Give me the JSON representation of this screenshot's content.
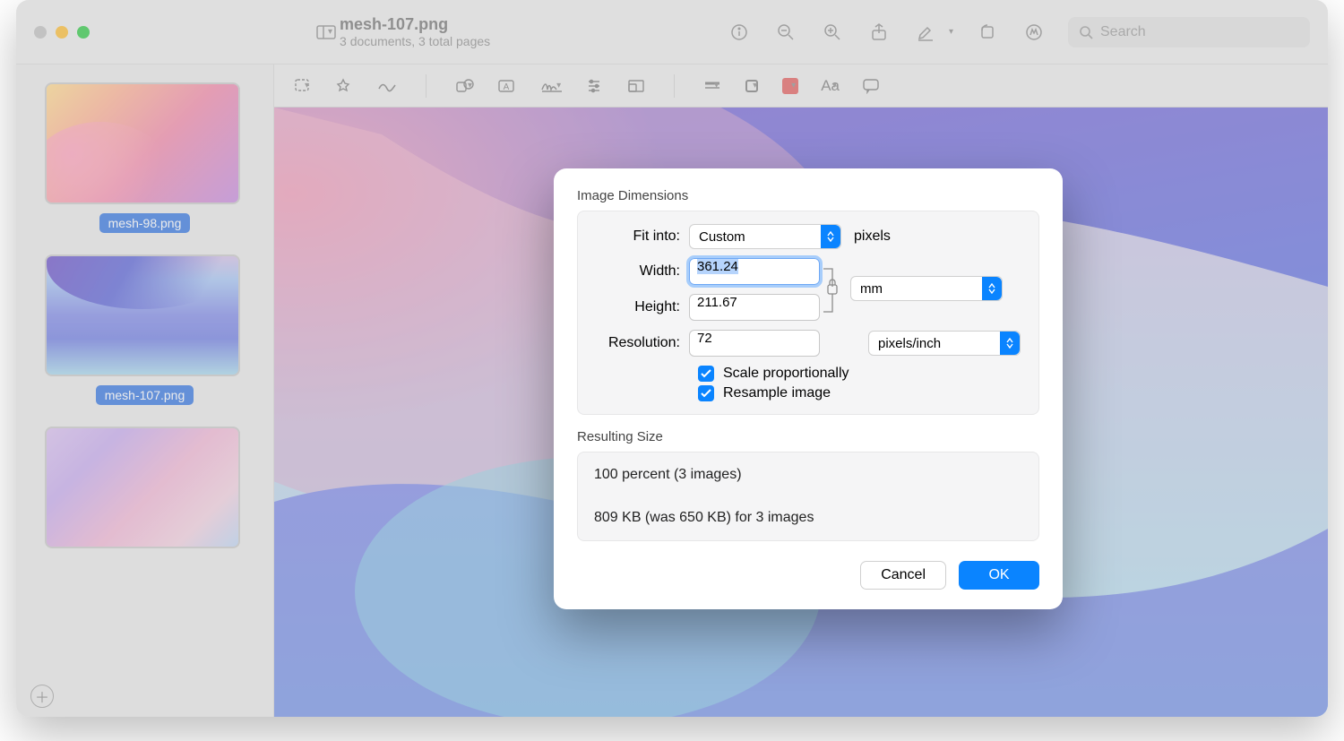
{
  "window": {
    "title": "mesh-107.png",
    "subtitle": "3 documents, 3 total pages",
    "search_placeholder": "Search"
  },
  "sidebar": {
    "thumbs": [
      {
        "label": "mesh-98.png"
      },
      {
        "label": "mesh-107.png"
      },
      {
        "label": ""
      }
    ]
  },
  "dialog": {
    "section_dimensions": "Image Dimensions",
    "fit_into_label": "Fit into:",
    "fit_into_value": "Custom",
    "fit_into_unit": "pixels",
    "width_label": "Width:",
    "width_value": "361.24",
    "height_label": "Height:",
    "height_value": "211.67",
    "dim_unit_value": "mm",
    "resolution_label": "Resolution:",
    "resolution_value": "72",
    "resolution_unit_value": "pixels/inch",
    "scale_label": "Scale proportionally",
    "resample_label": "Resample image",
    "section_result": "Resulting Size",
    "result_line1": "100 percent (3 images)",
    "result_line2": "809 KB (was 650 KB) for 3 images",
    "cancel": "Cancel",
    "ok": "OK"
  }
}
